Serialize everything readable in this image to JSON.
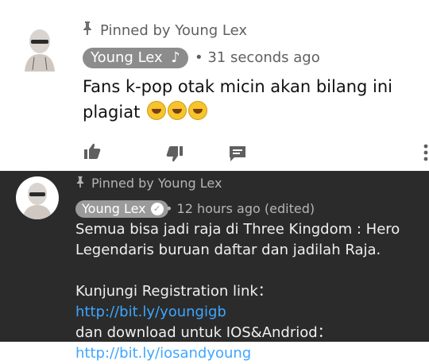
{
  "comment_light": {
    "pinned_label": "Pinned by Young Lex",
    "author": "Young Lex",
    "author_badge_icon": "music-note-icon",
    "time": "31 seconds ago",
    "text_line1": "Fans k-pop otak micin akan bilang ini",
    "text_line2": "plagiat",
    "emoji": "rolling-on-floor-laughing",
    "actions": [
      "like-icon",
      "dislike-icon",
      "reply-icon",
      "more-vert-icon"
    ]
  },
  "comment_dark": {
    "pinned_label": "Pinned by Young Lex",
    "author": "Young Lex",
    "author_badge_icon": "verified-check-icon",
    "time": "12 hours ago (edited)",
    "line1": "Semua bisa jadi raja di Three Kingdom : Hero",
    "line2": "Legendaris buruan daftar dan jadilah Raja.",
    "line3_prefix": "Kunjungi Registration link：",
    "link1": "http://bit.ly/youngigb",
    "line4": "dan download untuk IOS&Andriod：",
    "link2": "http://bit.ly/iosandyoung"
  },
  "colors": {
    "light_bg": "#ffffff",
    "dark_bg": "#2b2b2b",
    "link": "#3ea6ff",
    "chip_light": "#8c8c8c",
    "chip_dark": "#9a9a9a"
  }
}
